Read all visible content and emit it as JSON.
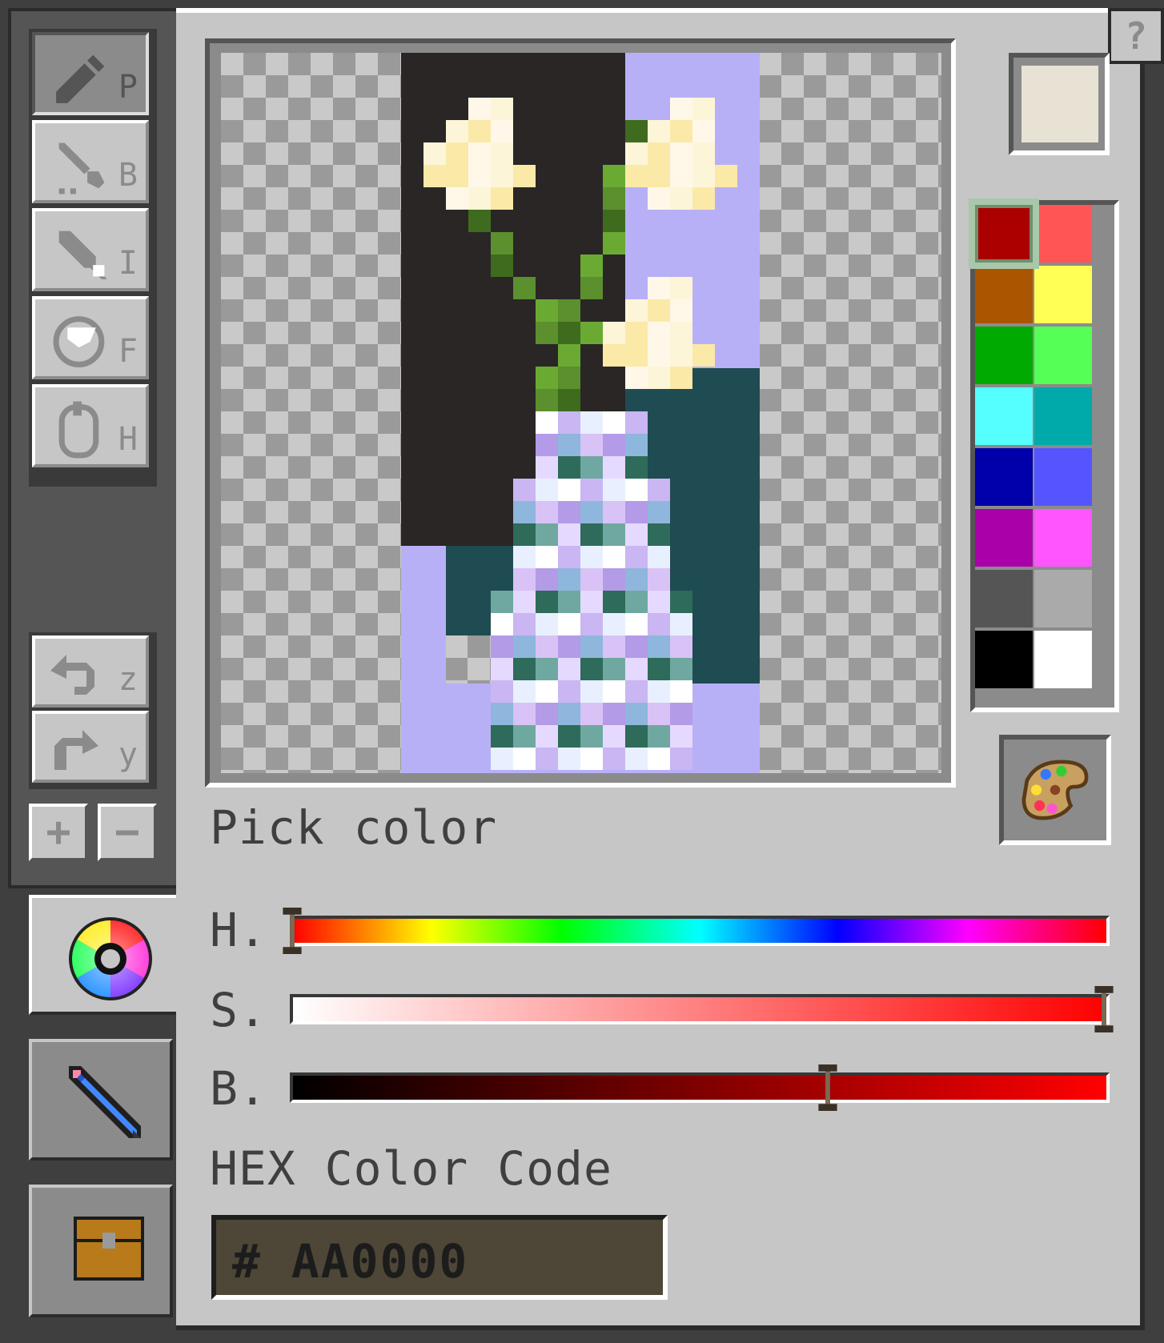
{
  "tools": [
    {
      "name": "pencil",
      "key": "P",
      "active": true
    },
    {
      "name": "brush",
      "key": "B",
      "active": false
    },
    {
      "name": "eyedropper",
      "key": "I",
      "active": false
    },
    {
      "name": "fill",
      "key": "F",
      "active": false
    },
    {
      "name": "hand",
      "key": "H",
      "active": false
    }
  ],
  "history": {
    "undo_key": "z",
    "redo_key": "y"
  },
  "zoom": {
    "plus": "+",
    "minus": "−"
  },
  "help_label": "?",
  "pick_color_label": "Pick color",
  "sliders": {
    "h_label": "H.",
    "s_label": "S.",
    "b_label": "B.",
    "h_value": 0.0,
    "s_value": 1.0,
    "b_value": 0.66
  },
  "hex": {
    "label": "HEX Color Code",
    "value": "# AA0000"
  },
  "current_color": "#e8e2d4",
  "palette": {
    "selected": "#aa0000",
    "colors": [
      [
        "#aa0000",
        "#ff5555"
      ],
      [
        "#aa5500",
        "#ffff55"
      ],
      [
        "#00aa00",
        "#55ff55"
      ],
      [
        "#55ffff",
        "#00aaaa"
      ],
      [
        "#0000aa",
        "#5555ff"
      ],
      [
        "#aa00aa",
        "#ff55ff"
      ],
      [
        "#555555",
        "#aaaaaa"
      ],
      [
        "#000000",
        "#ffffff"
      ]
    ]
  },
  "side_tabs": [
    "color-wheel",
    "pencil-edit",
    "chest-storage"
  ]
}
